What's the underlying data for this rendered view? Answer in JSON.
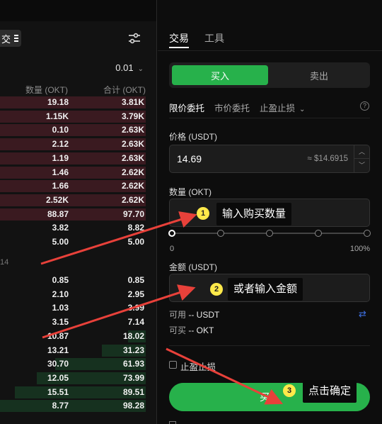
{
  "orderbook": {
    "segment_label": "交",
    "precision": "0.01",
    "col_qty": "数量 (OKT)",
    "col_sum": "合计 (OKT)",
    "mid_price_fragment": "14",
    "asks": [
      {
        "qty": "19.18",
        "sum": "3.81K",
        "depth": 1.0
      },
      {
        "qty": "1.15K",
        "sum": "3.79K",
        "depth": 1.0
      },
      {
        "qty": "0.10",
        "sum": "2.63K",
        "depth": 1.0
      },
      {
        "qty": "2.12",
        "sum": "2.63K",
        "depth": 1.0
      },
      {
        "qty": "1.19",
        "sum": "2.63K",
        "depth": 1.0
      },
      {
        "qty": "1.46",
        "sum": "2.62K",
        "depth": 1.0
      },
      {
        "qty": "1.66",
        "sum": "2.62K",
        "depth": 1.0
      },
      {
        "qty": "2.52K",
        "sum": "2.62K",
        "depth": 1.0
      },
      {
        "qty": "88.87",
        "sum": "97.70",
        "depth": 1.0
      },
      {
        "qty": "3.82",
        "sum": "8.82",
        "depth": 0.0
      },
      {
        "qty": "5.00",
        "sum": "5.00",
        "depth": 0.0
      }
    ],
    "bids": [
      {
        "qty": "0.85",
        "sum": "0.85",
        "depth": 0.0
      },
      {
        "qty": "2.10",
        "sum": "2.95",
        "depth": 0.0
      },
      {
        "qty": "1.03",
        "sum": "3.99",
        "depth": 0.0
      },
      {
        "qty": "3.15",
        "sum": "7.14",
        "depth": 0.0
      },
      {
        "qty": "10.87",
        "sum": "18.02",
        "depth": 0.12
      },
      {
        "qty": "13.21",
        "sum": "31.23",
        "depth": 0.3
      },
      {
        "qty": "30.70",
        "sum": "61.93",
        "depth": 0.62
      },
      {
        "qty": "12.05",
        "sum": "73.99",
        "depth": 0.75
      },
      {
        "qty": "15.51",
        "sum": "89.51",
        "depth": 0.9
      },
      {
        "qty": "8.77",
        "sum": "98.28",
        "depth": 1.0
      }
    ]
  },
  "panel": {
    "tab_trade": "交易",
    "tab_tools": "工具",
    "buy_label": "买入",
    "sell_label": "卖出",
    "order_limit": "限价委托",
    "order_market": "市价委托",
    "order_tpsl": "止盈止损",
    "help_symbol": "?",
    "price_label": "价格 (USDT)",
    "price_value": "14.69",
    "price_approx": "≈ $14.6915",
    "qty_label": "数量 (OKT)",
    "slider_min": "0",
    "slider_max": "100%",
    "slider_value": 0,
    "amount_label": "金额 (USDT)",
    "avail_label": "可用",
    "avail_value": "-- USDT",
    "canbuy_label": "可买",
    "canbuy_value": "-- OKT",
    "tpsl_check_label": "止盈止损",
    "submit_label": "买入"
  },
  "annotations": {
    "step1_num": "1",
    "step1_text": "输入购买数量",
    "step2_num": "2",
    "step2_text": "或者输入金额",
    "step3_num": "3",
    "step3_text": "点击确定"
  },
  "colors": {
    "buy_green": "#27b14b",
    "ask_depth": "#3a1a20",
    "bid_depth": "#16311f",
    "arrow_red": "#e8413a",
    "badge_yellow": "#ffe94a"
  }
}
